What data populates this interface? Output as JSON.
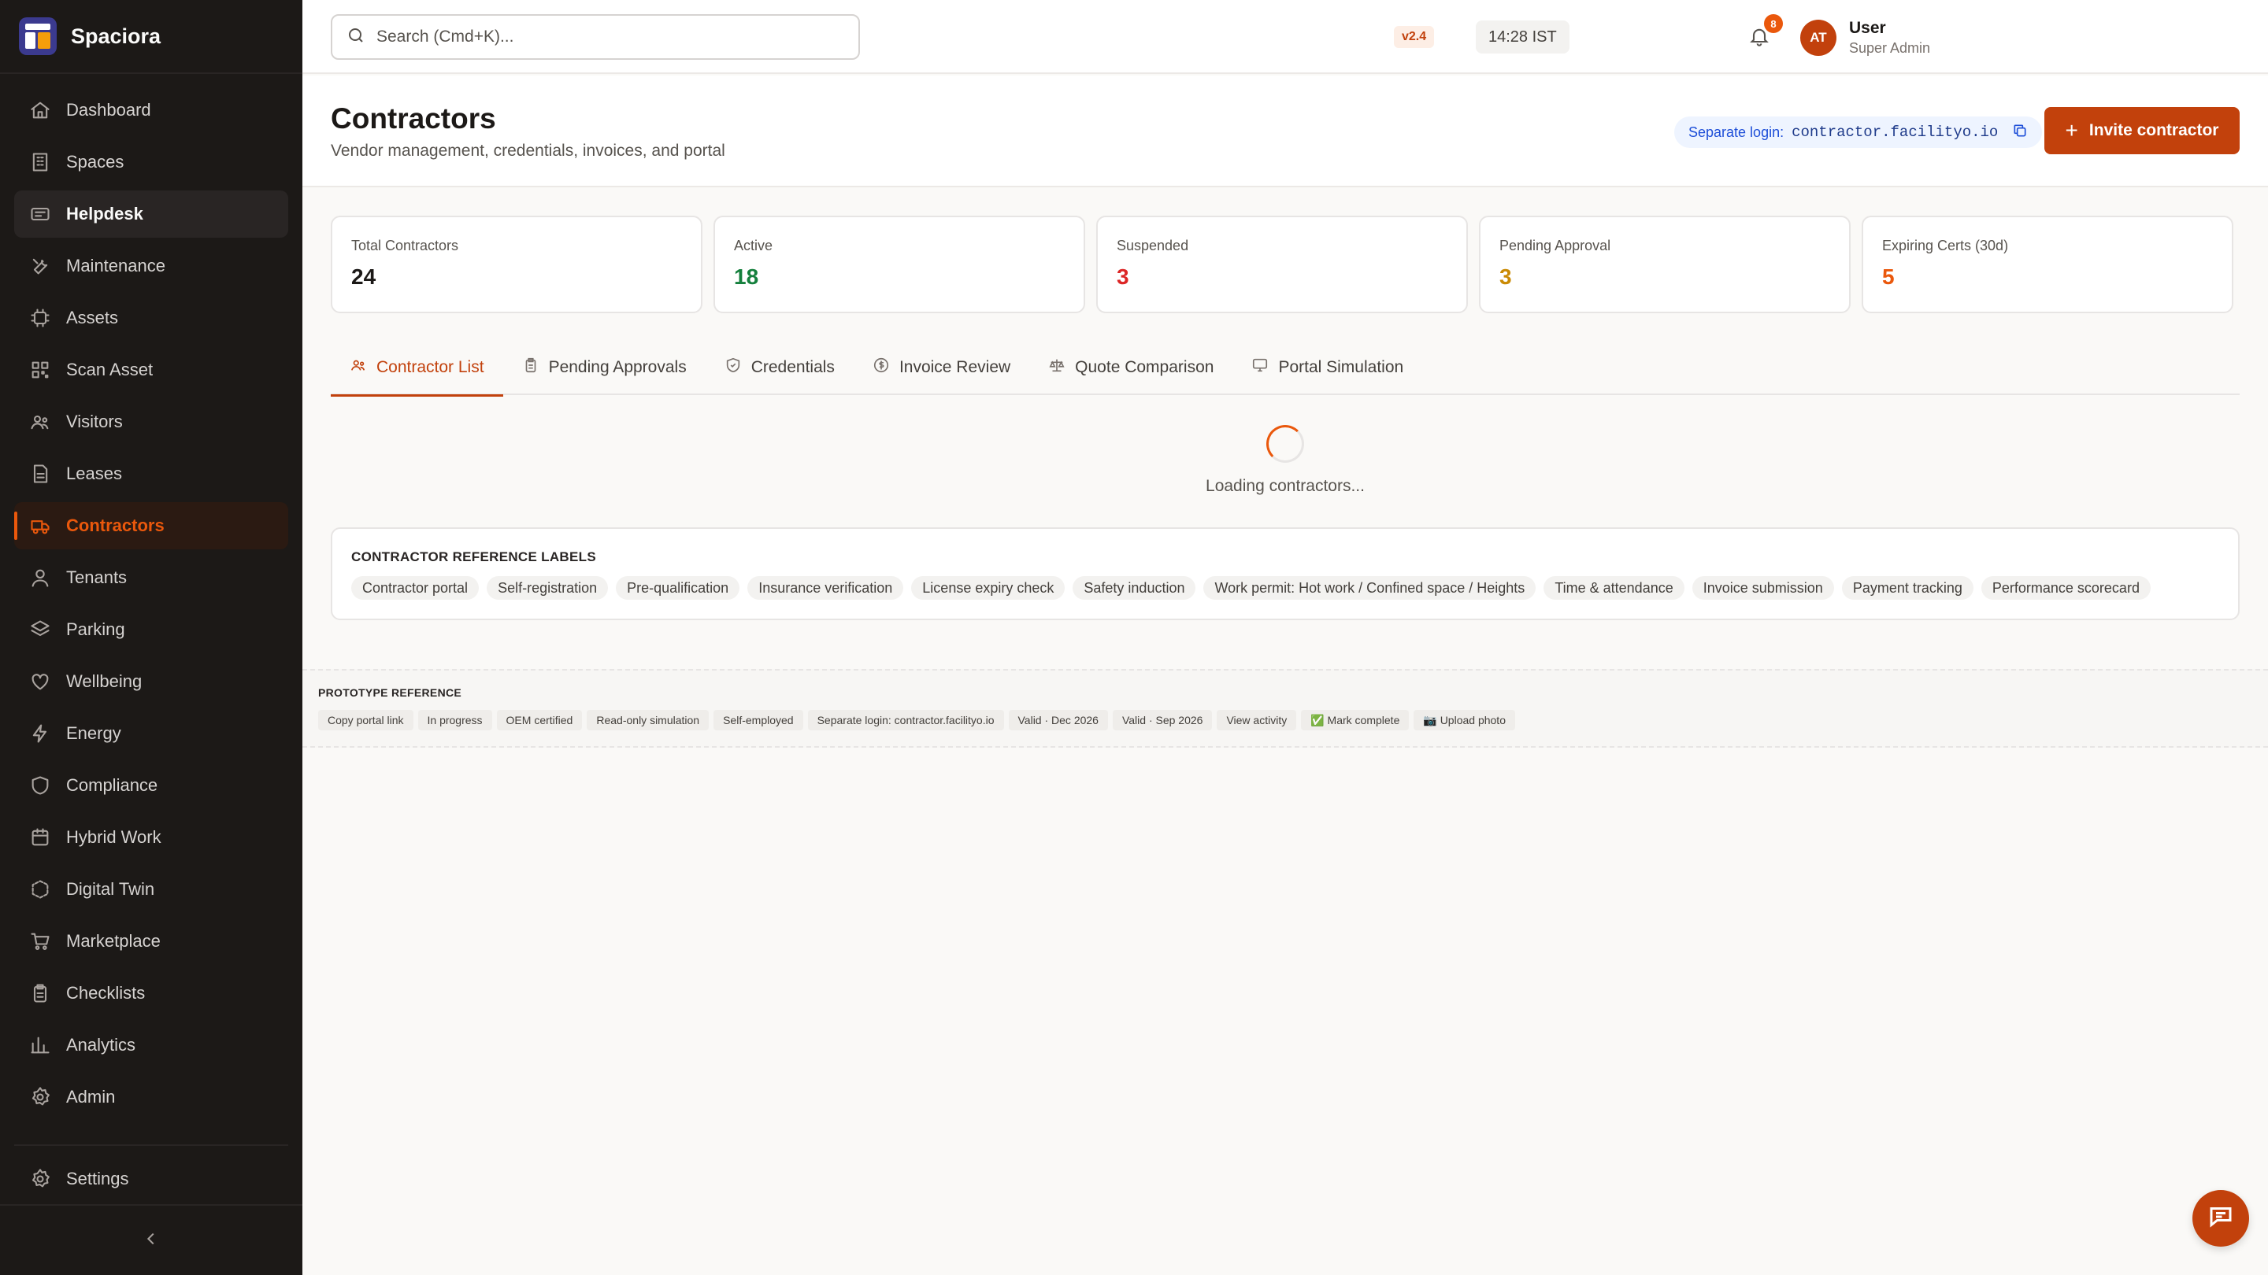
{
  "app": {
    "name": "Spaciora"
  },
  "sidebar": {
    "items": [
      {
        "label": "Dashboard",
        "icon": "home-icon"
      },
      {
        "label": "Spaces",
        "icon": "building-icon"
      },
      {
        "label": "Helpdesk",
        "icon": "ticket-icon"
      },
      {
        "label": "Maintenance",
        "icon": "wrench-icon"
      },
      {
        "label": "Assets",
        "icon": "chip-icon"
      },
      {
        "label": "Scan Asset",
        "icon": "qr-icon"
      },
      {
        "label": "Visitors",
        "icon": "users-icon"
      },
      {
        "label": "Leases",
        "icon": "document-icon"
      },
      {
        "label": "Contractors",
        "icon": "truck-icon"
      },
      {
        "label": "Tenants",
        "icon": "person-icon"
      },
      {
        "label": "Parking",
        "icon": "layers-icon"
      },
      {
        "label": "Wellbeing",
        "icon": "heart-icon"
      },
      {
        "label": "Energy",
        "icon": "bolt-icon"
      },
      {
        "label": "Compliance",
        "icon": "shield-icon"
      },
      {
        "label": "Hybrid Work",
        "icon": "calendar-icon"
      },
      {
        "label": "Digital Twin",
        "icon": "cube-icon"
      },
      {
        "label": "Marketplace",
        "icon": "cart-icon"
      },
      {
        "label": "Checklists",
        "icon": "clipboard-icon"
      },
      {
        "label": "Analytics",
        "icon": "bar-chart-icon"
      },
      {
        "label": "Admin",
        "icon": "gear-icon"
      }
    ],
    "settings_label": "Settings",
    "active": "Contractors"
  },
  "topbar": {
    "search_placeholder": "Search (Cmd+K)...",
    "version": "v2.4",
    "time": "14:28 IST",
    "notification_count": "8",
    "avatar_initials": "AT",
    "user_name": "User",
    "user_role": "Super Admin"
  },
  "header": {
    "title": "Contractors",
    "subtitle": "Vendor management, credentials, invoices, and portal",
    "login_label": "Separate login:",
    "login_url": "contractor.facilityo.io",
    "invite_label": "Invite contractor"
  },
  "stats": [
    {
      "label": "Total Contractors",
      "value": "24",
      "color": "#1c1917"
    },
    {
      "label": "Active",
      "value": "18",
      "color": "#15803d"
    },
    {
      "label": "Suspended",
      "value": "3",
      "color": "#dc2626"
    },
    {
      "label": "Pending Approval",
      "value": "3",
      "color": "#ca8a04"
    },
    {
      "label": "Expiring Certs (30d)",
      "value": "5",
      "color": "#ea580c"
    }
  ],
  "tabs": [
    {
      "label": "Contractor List",
      "icon": "users-icon"
    },
    {
      "label": "Pending Approvals",
      "icon": "clipboard-icon"
    },
    {
      "label": "Credentials",
      "icon": "shield-check-icon"
    },
    {
      "label": "Invoice Review",
      "icon": "dollar-icon"
    },
    {
      "label": "Quote Comparison",
      "icon": "scale-icon"
    },
    {
      "label": "Portal Simulation",
      "icon": "monitor-icon"
    }
  ],
  "loading_text": "Loading contractors...",
  "reference": {
    "title": "CONTRACTOR REFERENCE LABELS",
    "chips": [
      "Contractor portal",
      "Self-registration",
      "Pre-qualification",
      "Insurance verification",
      "License expiry check",
      "Safety induction",
      "Work permit: Hot work / Confined space / Heights",
      "Time & attendance",
      "Invoice submission",
      "Payment tracking",
      "Performance scorecard"
    ]
  },
  "prototype": {
    "title": "PROTOTYPE REFERENCE",
    "chips": [
      "Copy portal link",
      "In progress",
      "OEM certified",
      "Read-only simulation",
      "Self-employed",
      "Separate login: contractor.facilityo.io",
      "Valid · Dec 2026",
      "Valid · Sep 2026",
      "View activity",
      "✅ Mark complete",
      "📷 Upload photo"
    ]
  },
  "colors": {
    "accent": "#c2410c",
    "sidebar_bg": "#1c1917"
  }
}
